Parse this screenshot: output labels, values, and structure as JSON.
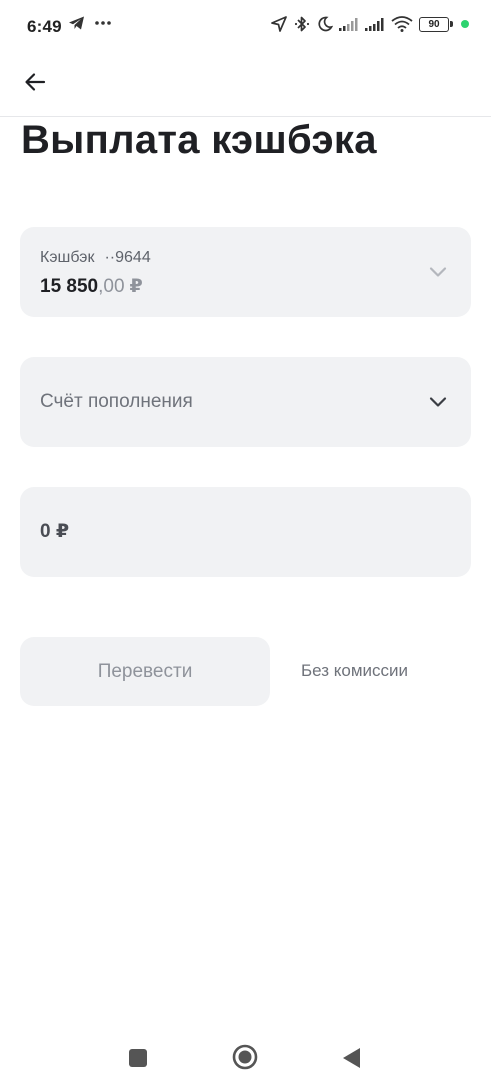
{
  "status_bar": {
    "time": "6:49",
    "battery": "90",
    "icons": [
      "telegram-icon",
      "more-dots-icon",
      "location-icon",
      "bluetooth-icon",
      "moon-icon",
      "signal-icon",
      "signal-icon",
      "wifi-icon",
      "battery-icon"
    ],
    "indicator_color": "#2dd36f"
  },
  "header": {
    "back_icon": "arrow-left-icon",
    "title": "Выплата кэшбэка"
  },
  "account_card": {
    "label": "Кэшбэк",
    "mask": "··9644",
    "amount_int": "15 850",
    "amount_frac": ",00",
    "currency": "₽",
    "icon": "chevron-down-icon"
  },
  "target_card": {
    "placeholder": "Счёт пополнения",
    "icon": "chevron-down-icon"
  },
  "amount_field": {
    "value": "0 ₽"
  },
  "actions": {
    "transfer_label": "Перевести",
    "fee_note": "Без комиссии"
  },
  "colors": {
    "card_bg": "#f1f2f4",
    "text_primary": "#1f2024",
    "text_muted": "#8f939b"
  }
}
